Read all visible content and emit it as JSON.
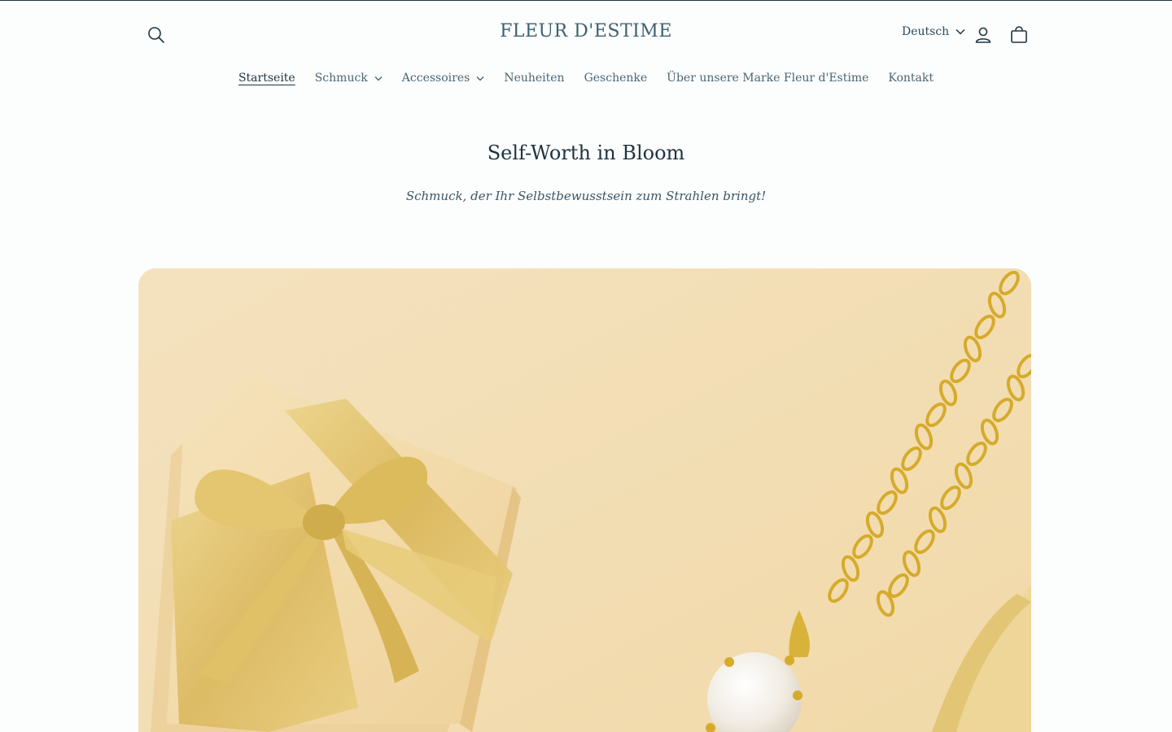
{
  "header": {
    "brand": "FLEUR D'ESTIME",
    "language": "Deutsch",
    "icons": {
      "search": "search-icon",
      "account": "account-icon",
      "cart": "cart-icon"
    }
  },
  "nav": {
    "items": [
      {
        "label": "Startseite",
        "active": true,
        "dropdown": false
      },
      {
        "label": "Schmuck",
        "active": false,
        "dropdown": true
      },
      {
        "label": "Accessoires",
        "active": false,
        "dropdown": true
      },
      {
        "label": "Neuheiten",
        "active": false,
        "dropdown": false
      },
      {
        "label": "Geschenke",
        "active": false,
        "dropdown": false
      },
      {
        "label": "Über unsere Marke Fleur d'Estime",
        "active": false,
        "dropdown": false
      },
      {
        "label": "Kontakt",
        "active": false,
        "dropdown": false
      }
    ]
  },
  "hero": {
    "title": "Self-Worth in Bloom",
    "subtitle": "Schmuck, der Ihr Selbstbewusstsein zum Strahlen bringt!"
  },
  "colors": {
    "background": "#fcfdfd",
    "text": "#1f3440",
    "accent": "#3f6070",
    "image_bg": "#f3ddb4",
    "gold": "#d8b54a"
  }
}
